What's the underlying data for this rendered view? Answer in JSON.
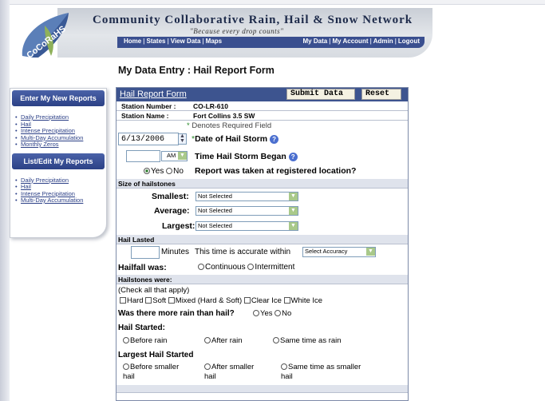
{
  "header": {
    "site_title": "Community Collaborative Rain, Hail & Snow Network",
    "tagline": "\"Because every drop counts\"",
    "logo_text": "CoCoRaHS",
    "nav_left": [
      "Home",
      "States",
      "View Data",
      "Maps"
    ],
    "nav_right": [
      "My Data",
      "My Account",
      "Admin",
      "Logout"
    ]
  },
  "page_title": "My Data Entry : Hail Report Form",
  "sidebar": {
    "heading_new": "Enter My New Reports",
    "new_items": [
      "Daily Precipitation",
      "Hail",
      "Intense Precipitation",
      "Multi-Day Accumulation",
      "Monthly Zeros"
    ],
    "heading_edit": "List/Edit My Reports",
    "edit_items": [
      "Daily Precipitation",
      "Hail",
      "Intense Precipitation",
      "Multi-Day Accumulation"
    ]
  },
  "form": {
    "title": "Hail Report Form",
    "submit_label": "Submit Data",
    "reset_label": "Reset",
    "station_number_label": "Station Number :",
    "station_number": "CO-LR-610",
    "station_name_label": "Station Name :",
    "station_name": "Fort Collins 3.5 SW",
    "required_note": "Denotes Required Field",
    "date_value": "6/13/2006",
    "date_label": "Date of Hail Storm",
    "time_ampm": "AM",
    "time_label": "Time Hail Storm Began",
    "loc_yes": "Yes",
    "loc_no": "No",
    "loc_label": "Report was taken at registered location?",
    "size_section": "Size of hailstones",
    "smallest_label": "Smallest:",
    "average_label": "Average:",
    "largest_label": "Largest:",
    "size_placeholder": "Not Selected",
    "lasted_section": "Hail Lasted",
    "minutes_label": "Minutes",
    "accuracy_text": "This time is accurate within",
    "accuracy_placeholder": "Select Accuracy",
    "hailfall_label": "Hailfall was:",
    "continuous": "Continuous",
    "intermittent": "Intermittent",
    "were_section": "Hailstones were:",
    "check_all": "(Check all that apply)",
    "checks": [
      "Hard",
      "Soft",
      "Mixed (Hard & Soft)",
      "Clear Ice",
      "White Ice"
    ],
    "rain_question": "Was there more rain than hail?",
    "rain_yes": "Yes",
    "rain_no": "No",
    "started_label": "Hail Started:",
    "started_options": [
      "Before rain",
      "After rain",
      "Same time as rain"
    ],
    "largest_started_label": "Largest Hail Started",
    "largest_opt1_a": "Before smaller",
    "largest_opt1_b": "hail",
    "largest_opt2_a": "After smaller",
    "largest_opt2_b": "hail",
    "largest_opt3_a": "Same time as smaller",
    "largest_opt3_b": "hail"
  },
  "colors": {
    "nav_blue": "#3a4f8f",
    "form_header": "#3d548f",
    "link_blue": "#2b3f86",
    "section_bg": "#dfe3ec"
  }
}
